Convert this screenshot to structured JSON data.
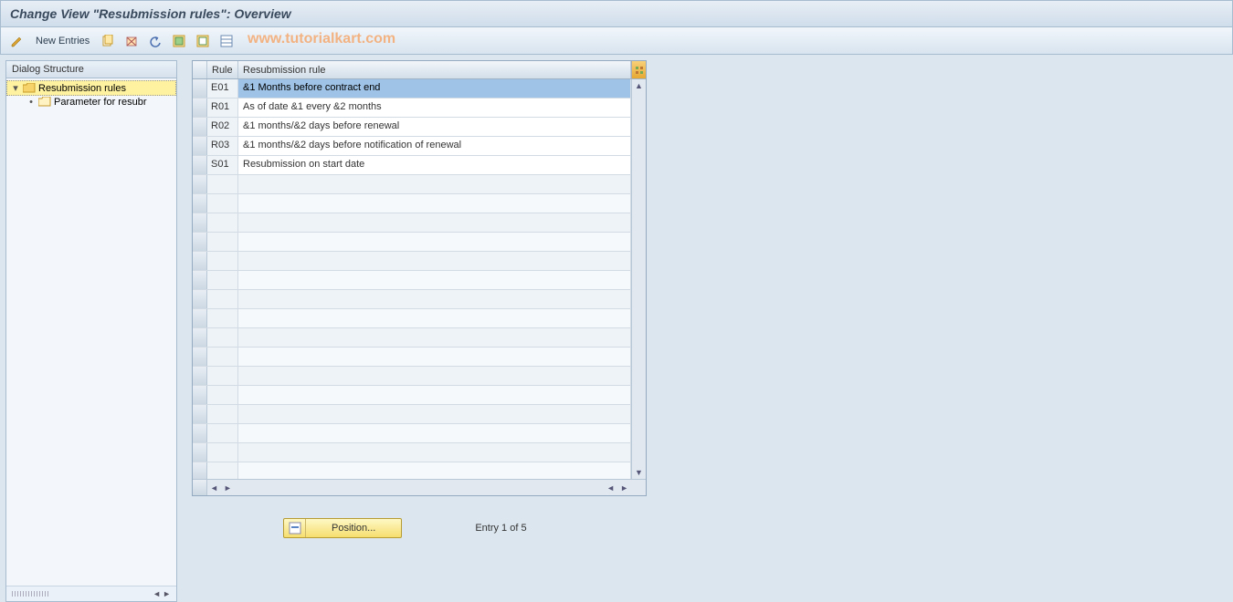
{
  "title": "Change View \"Resubmission rules\": Overview",
  "watermark": "www.tutorialkart.com",
  "toolbar": {
    "new_entries": "New Entries"
  },
  "sidebar": {
    "header": "Dialog Structure",
    "items": [
      {
        "label": "Resubmission rules",
        "selected": true,
        "open": true
      },
      {
        "label": "Parameter for resubr",
        "selected": false,
        "open": false
      }
    ]
  },
  "table": {
    "columns": {
      "rule": "Rule",
      "desc": "Resubmission rule"
    },
    "rows": [
      {
        "rule": "E01",
        "desc": "&1 Months before contract end",
        "selected": true
      },
      {
        "rule": "R01",
        "desc": "As of date &1 every &2 months"
      },
      {
        "rule": "R02",
        "desc": "&1 months/&2 days before renewal"
      },
      {
        "rule": "R03",
        "desc": "&1 months/&2 days before notification of renewal"
      },
      {
        "rule": "S01",
        "desc": "Resubmission on start date"
      }
    ],
    "empty_rows": 16
  },
  "footer": {
    "position_label": "Position...",
    "entry_text": "Entry 1 of 5"
  }
}
